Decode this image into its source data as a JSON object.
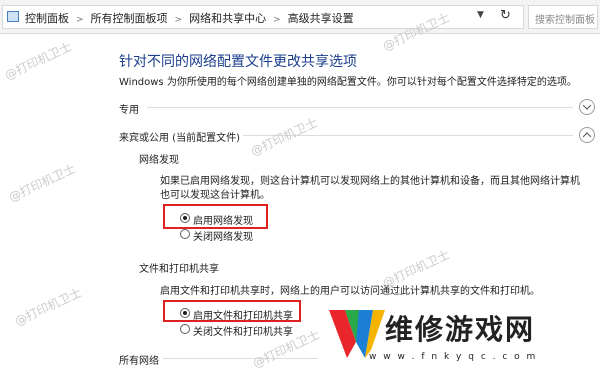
{
  "address_bar": {
    "crumbs": [
      "控制面板",
      "所有控制面板项",
      "网络和共享中心",
      "高级共享设置"
    ],
    "search_placeholder": "搜索控制面板"
  },
  "page": {
    "title": "针对不同的网络配置文件更改共享选项",
    "description": "Windows 为你所使用的每个网络创建单独的网络配置文件。你可以针对每个配置文件选择特定的选项。"
  },
  "sections": {
    "private": {
      "label": "专用"
    },
    "guest": {
      "label": "来宾或公用 (当前配置文件)"
    },
    "all": {
      "label": "所有网络"
    }
  },
  "network_discovery": {
    "heading": "网络发现",
    "description": "如果已启用网络发现，则这台计算机可以发现网络上的其他计算机和设备，而且其他网络计算机也可以发现这台计算机。",
    "options": [
      "启用网络发现",
      "关闭网络发现"
    ],
    "selected": "启用网络发现"
  },
  "file_printer_sharing": {
    "heading": "文件和打印机共享",
    "description": "启用文件和打印机共享时，网络上的用户可以访问通过此计算机共享的文件和打印机。",
    "options": [
      "启用文件和打印机共享",
      "关闭文件和打印机共享"
    ],
    "selected": "启用文件和打印机共享"
  },
  "watermark": {
    "text": "@打印机卫士"
  },
  "brand": {
    "text": "维修游戏网",
    "url": "w w w . f n k y q c . c o m",
    "colors": [
      "#e8262b",
      "#2aa84a",
      "#1b7fd6",
      "#f5b400"
    ]
  },
  "colors": {
    "title": "#1c3e8c",
    "highlight": "#e02020"
  }
}
